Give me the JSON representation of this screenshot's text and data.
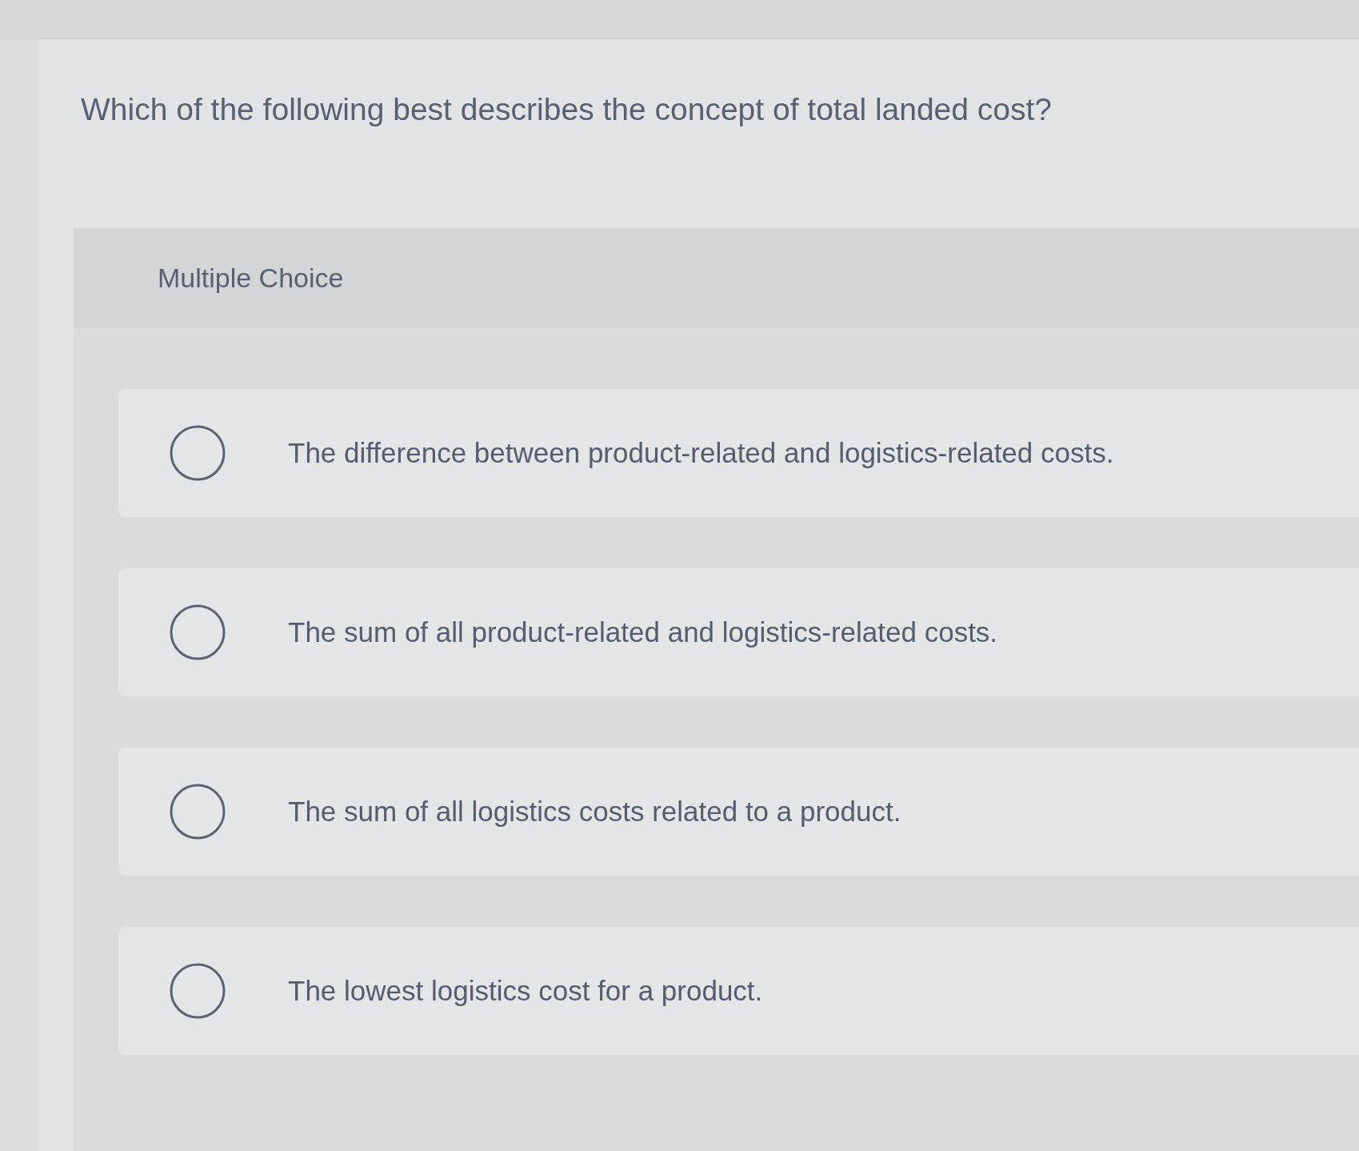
{
  "question": {
    "text": "Which of the following best describes the concept of total landed cost?"
  },
  "question_type": {
    "label": "Multiple Choice"
  },
  "options": [
    {
      "text": "The difference between product-related and logistics-related costs.",
      "selected": false
    },
    {
      "text": "The sum of all product-related and logistics-related costs.",
      "selected": false
    },
    {
      "text": "The sum of all logistics costs related to a product.",
      "selected": false
    },
    {
      "text": "The lowest logistics cost for a product.",
      "selected": false
    }
  ]
}
